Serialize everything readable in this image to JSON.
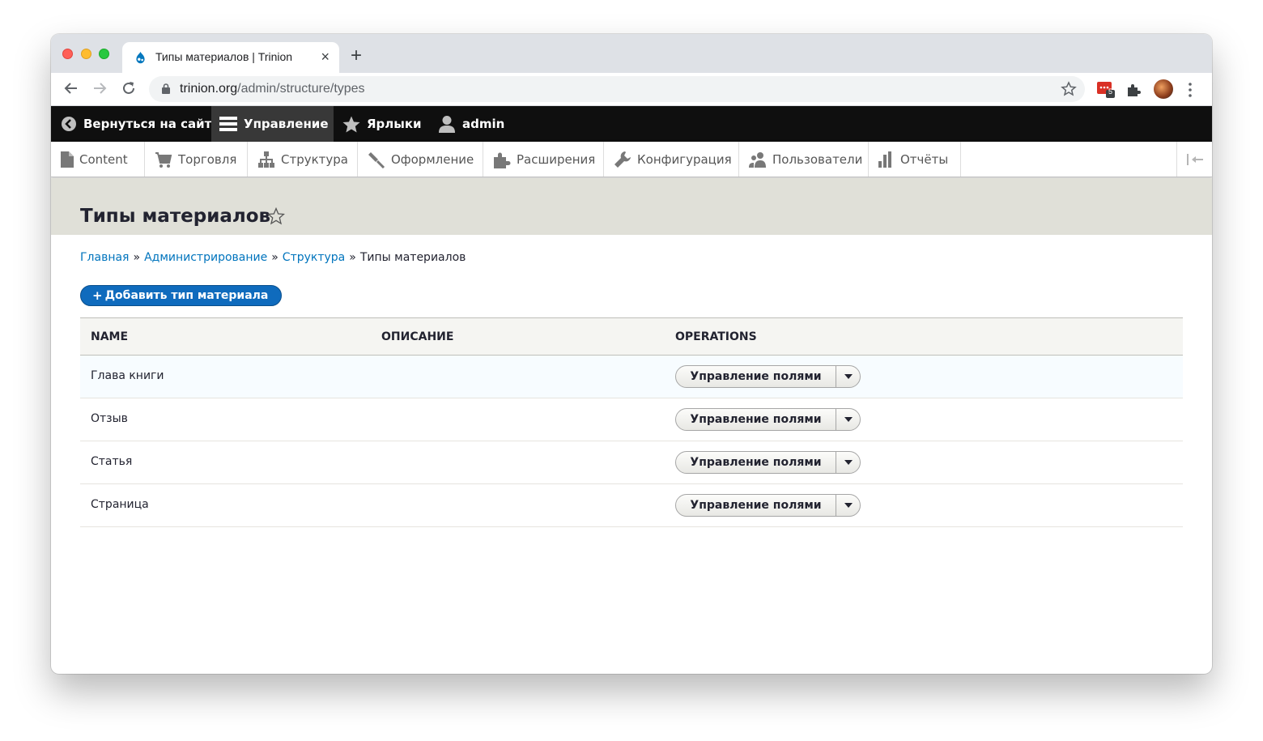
{
  "browser": {
    "tab_title": "Типы материалов | Trinion",
    "tab_close": "×",
    "new_tab": "+",
    "url_host": "trinion.org",
    "url_path": "/admin/structure/types",
    "extension_badge": "5"
  },
  "toolbar": {
    "back_to_site": "Вернуться на сайт",
    "manage": "Управление",
    "shortcuts": "Ярлыки",
    "user": "admin"
  },
  "tray": {
    "items": [
      {
        "label": "Content"
      },
      {
        "label": "Торговля"
      },
      {
        "label": "Структура"
      },
      {
        "label": "Оформление"
      },
      {
        "label": "Расширения"
      },
      {
        "label": "Конфигурация"
      },
      {
        "label": "Пользователи"
      },
      {
        "label": "Отчёты"
      }
    ]
  },
  "page": {
    "title": "Типы материалов",
    "breadcrumb": [
      {
        "label": "Главная",
        "link": true
      },
      {
        "label": "Администрирование",
        "link": true
      },
      {
        "label": "Структура",
        "link": true
      },
      {
        "label": "Типы материалов",
        "link": false
      }
    ],
    "breadcrumb_separator": "»",
    "add_button_plus": "+",
    "add_button": "Добавить тип материала"
  },
  "table": {
    "headers": [
      "Name",
      "Описание",
      "Operations"
    ],
    "rows": [
      {
        "name": "Глава книги",
        "operation": "Управление полями"
      },
      {
        "name": "Отзыв",
        "operation": "Управление полями"
      },
      {
        "name": "Статья",
        "operation": "Управление полями"
      },
      {
        "name": "Страница",
        "operation": "Управление полями"
      }
    ]
  },
  "colors": {
    "toolbar_bg": "#0f0f0f",
    "toolbar_active": "#383838",
    "link": "#0074bd",
    "primary_button": "#0f6bbd",
    "header_bg": "#e0e0d8"
  },
  "icons": [
    "drupal-favicon-icon",
    "back-arrow-icon",
    "forward-arrow-icon",
    "reload-icon",
    "lock-icon",
    "bookmark-star-icon",
    "extension-icon",
    "puzzle-icon",
    "avatar",
    "kebab-menu-icon",
    "chevron-left-circle-icon",
    "hamburger-icon",
    "star-icon",
    "user-icon",
    "file-icon",
    "cart-icon",
    "sitemap-icon",
    "brush-icon",
    "puzzle-icon",
    "wrench-icon",
    "people-icon",
    "bar-chart-icon",
    "collapse-tray-icon",
    "favorite-star-icon",
    "caret-down-icon"
  ]
}
